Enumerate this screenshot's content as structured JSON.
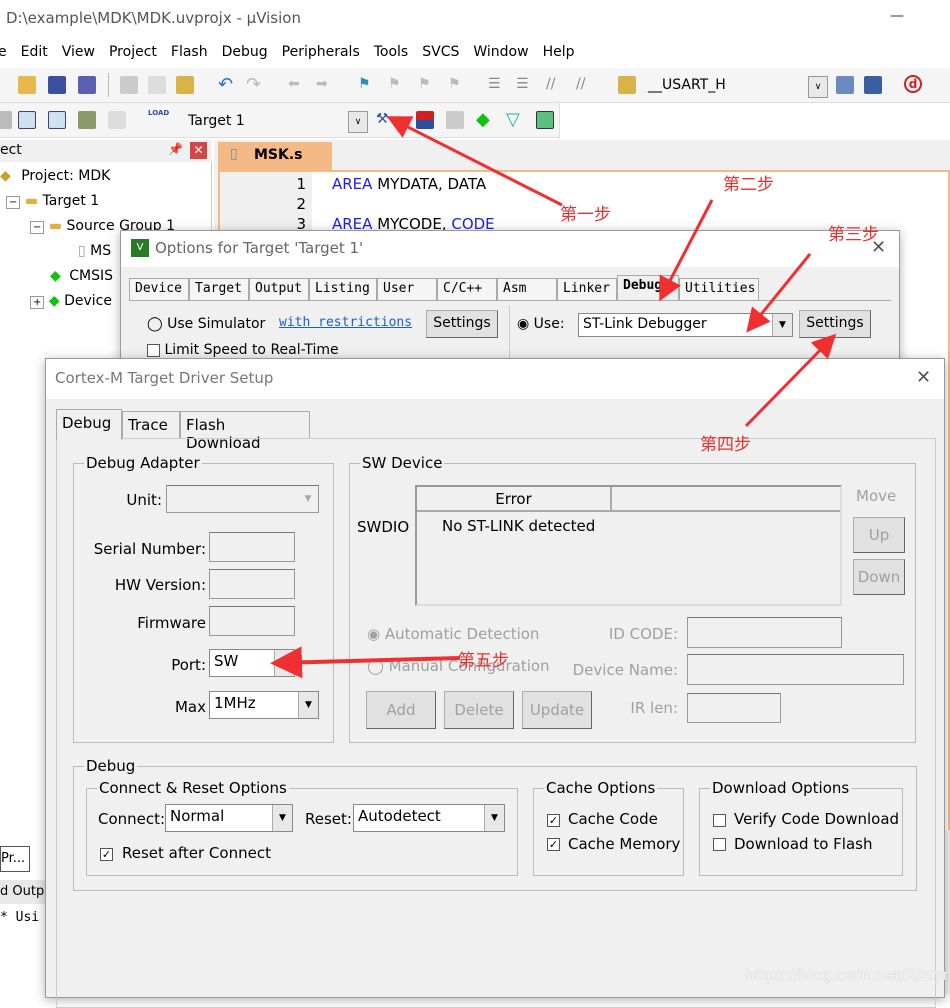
{
  "window": {
    "title": "D:\\example\\MDK\\MDK.uvprojx - µVision",
    "minimize": "—"
  },
  "menu": [
    "e",
    "Edit",
    "View",
    "Project",
    "Flash",
    "Debug",
    "Peripherals",
    "Tools",
    "SVCS",
    "Window",
    "Help"
  ],
  "toolbar": {
    "find_combo": "__USART_H",
    "target_combo": "Target 1"
  },
  "project_panel": {
    "title": "ect",
    "tree": [
      "Project: MDK",
      "Target 1",
      "Source Group 1",
      "MS",
      "CMSIS",
      "Device"
    ]
  },
  "editor": {
    "tab": "MSK.s",
    "lines": [
      {
        "n": "1",
        "kw": "AREA",
        "rest": " MYDATA, DATA",
        "kw2": ""
      },
      {
        "n": "2",
        "kw": "",
        "rest": "",
        "kw2": ""
      },
      {
        "n": "3",
        "kw": "AREA",
        "rest": " MYCODE, ",
        "kw2": "CODE"
      }
    ]
  },
  "bottom_panel": {
    "tab1": "Pr...",
    "tab2": "d Outp",
    "output": "* Usi"
  },
  "options_dialog": {
    "title": "Options for Target 'Target 1'",
    "tabs": [
      "Device",
      "Target",
      "Output",
      "Listing",
      "User",
      "C/C++",
      "Asm",
      "Linker",
      "Debug",
      "Utilities"
    ],
    "active_tab": "Debug",
    "use_simulator": "Use Simulator",
    "with_restrictions": "with restrictions",
    "settings": "Settings",
    "limit_speed": "Limit Speed to Real-Time",
    "use": "Use:",
    "debugger": "ST-Link Debugger",
    "settings2": "Settings"
  },
  "driver_dialog": {
    "title": "Cortex-M Target Driver Setup",
    "tabs": [
      "Debug",
      "Trace",
      "Flash Download"
    ],
    "adapter": {
      "group": "Debug Adapter",
      "unit": "Unit:",
      "serial": "Serial Number:",
      "hw": "HW Version:",
      "firmware": "Firmware",
      "port": "Port:",
      "port_value": "SW",
      "max": "Max",
      "max_value": "1MHz"
    },
    "sw": {
      "group": "SW Device",
      "swdio": "SWDIO",
      "col1": "Error",
      "row": "No ST-LINK detected",
      "move": "Move",
      "up": "Up",
      "down": "Down",
      "auto": "Automatic Detection",
      "manual": "Manual Configuration",
      "idcode": "ID CODE:",
      "devname": "Device Name:",
      "irlen": "IR len:",
      "add": "Add",
      "delete": "Delete",
      "update": "Update"
    },
    "debug": {
      "group": "Debug",
      "cr_group": "Connect & Reset Options",
      "connect": "Connect:",
      "connect_value": "Normal",
      "reset": "Reset:",
      "reset_value": "Autodetect",
      "reset_after": "Reset after Connect",
      "cache_group": "Cache Options",
      "cache_code": "Cache Code",
      "cache_memory": "Cache Memory",
      "dl_group": "Download Options",
      "verify": "Verify Code Download",
      "dl_flash": "Download to Flash"
    }
  },
  "annotations": [
    "第一步",
    "第二步",
    "第三步",
    "第四步",
    "第五步"
  ],
  "watermark": "https://blog.csdn.net/XJztym"
}
